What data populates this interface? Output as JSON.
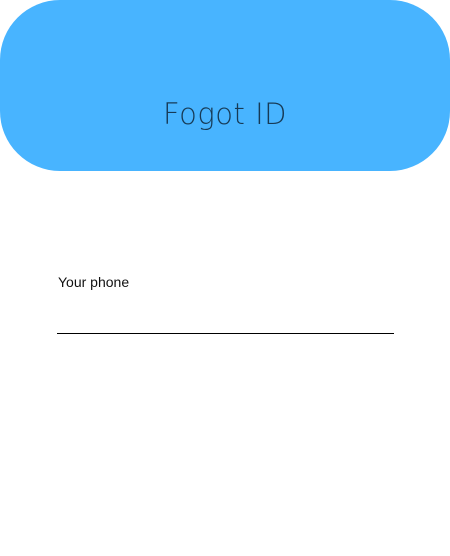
{
  "header": {
    "title": "Fogot ID"
  },
  "form": {
    "phone_label": "Your phone",
    "phone_value": ""
  },
  "colors": {
    "header_background": "#48b4ff",
    "header_text": "#173a55",
    "underline": "#000000"
  }
}
